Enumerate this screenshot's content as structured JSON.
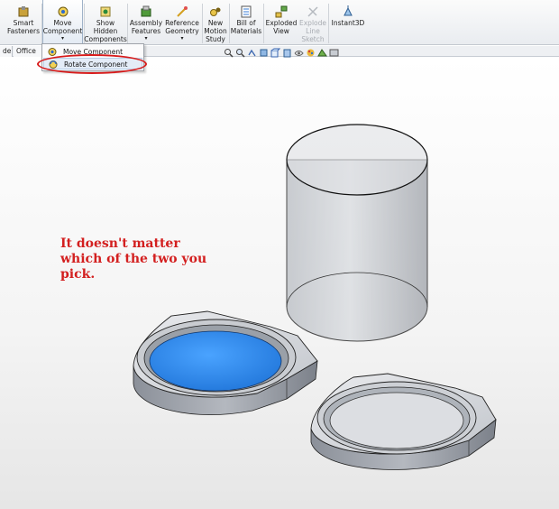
{
  "ribbon": {
    "items": [
      {
        "id": "smart-fasteners",
        "line1": "Smart",
        "line2": "Fasteners",
        "line3": "",
        "icon": "smart-fasteners-icon",
        "disabled": false
      },
      {
        "id": "move-component",
        "line1": "Move",
        "line2": "Component",
        "line3": "",
        "icon": "move-component-icon",
        "disabled": false,
        "has_dropdown": true
      },
      {
        "id": "show-hidden-components",
        "line1": "Show",
        "line2": "Hidden",
        "line3": "Components",
        "icon": "show-hidden-icon",
        "disabled": false
      },
      {
        "id": "assembly-features",
        "line1": "Assembly",
        "line2": "Features",
        "line3": "",
        "icon": "assembly-features-icon",
        "disabled": false,
        "has_dropdown": true
      },
      {
        "id": "reference-geometry",
        "line1": "Reference",
        "line2": "Geometry",
        "line3": "",
        "icon": "reference-geometry-icon",
        "disabled": false,
        "has_dropdown": true
      },
      {
        "id": "new-motion-study",
        "line1": "New",
        "line2": "Motion",
        "line3": "Study",
        "icon": "motion-study-icon",
        "disabled": false
      },
      {
        "id": "bill-of-materials",
        "line1": "Bill of",
        "line2": "Materials",
        "line3": "",
        "icon": "bom-icon",
        "disabled": false
      },
      {
        "id": "exploded-view",
        "line1": "Exploded",
        "line2": "View",
        "line3": "",
        "icon": "exploded-view-icon",
        "disabled": false
      },
      {
        "id": "explode-line-sketch",
        "line1": "Explode",
        "line2": "Line",
        "line3": "Sketch",
        "icon": "explode-line-sketch-icon",
        "disabled": true
      },
      {
        "id": "instant3d",
        "line1": "Instant3D",
        "line2": "",
        "line3": "",
        "icon": "instant3d-icon",
        "disabled": false
      }
    ],
    "caret": "▾"
  },
  "tabs": [
    {
      "label": "de"
    },
    {
      "label": "Office P"
    }
  ],
  "menu": {
    "items": [
      {
        "label": "Move Component",
        "icon": "move-component-icon"
      },
      {
        "label": "Rotate Component",
        "icon": "rotate-component-icon"
      }
    ]
  },
  "annotation": {
    "line1": "It doesn't matter",
    "line2": "which of the two you",
    "line3": "pick."
  },
  "colors": {
    "annotation_red": "#d31f1f",
    "selected_face_blue": "#2e86f0",
    "part_gray": "#a9afb9",
    "highlight_ring": "#d81a1a"
  }
}
